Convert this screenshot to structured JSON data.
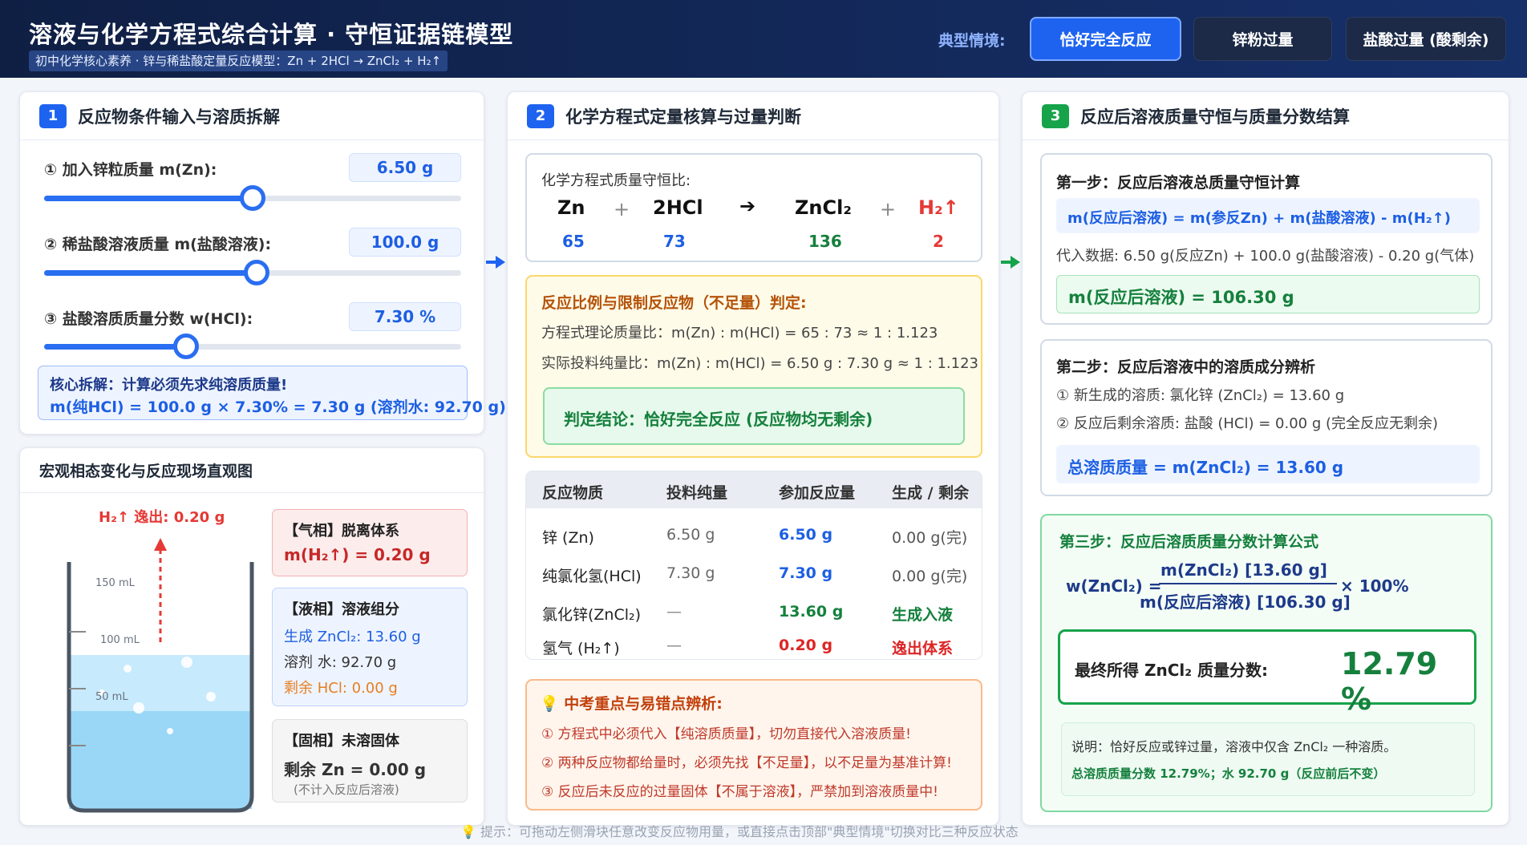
{
  "header": {
    "title": "溶液与化学方程式综合计算 · 守恒证据链模型",
    "subtitle": "初中化学核心素养 · 锌与稀盐酸定量反应模型：Zn + 2HCl → ZnCl₂ + H₂↑",
    "scenario_label": "典型情境:",
    "scenarios": [
      "恰好完全反应",
      "锌粉过量",
      "盐酸过量 (酸剩余)"
    ]
  },
  "panel1": {
    "num": "1",
    "title": "反应物条件输入与溶质拆解",
    "zn_label": "① 加入锌粒质量 m(Zn):",
    "zn_value": "6.50 g",
    "zn_fraction": 0.5,
    "hcl_sol_label": "② 稀盐酸溶液质量 m(盐酸溶液):",
    "hcl_sol_value": "100.0 g",
    "hcl_sol_fraction": 0.51,
    "w_label": "③ 盐酸溶质质量分数 w(HCl):",
    "w_value": "7.30 %",
    "w_fraction": 0.34,
    "core_line1": "核心拆解：计算必须先求纯溶质质量!",
    "core_line2": "m(纯HCl) = 100.0 g × 7.30% = 7.30 g (溶剂水: 92.70 g)"
  },
  "macro": {
    "title": "宏观相态变化与反应现场直观图",
    "h2_escape": "H₂↑ 逸出: 0.20 g",
    "marks": [
      "150 mL",
      "100 mL",
      "50 mL"
    ],
    "gas_title": "【气相】脱离体系",
    "gas_value": "m(H₂↑) = 0.20 g",
    "liquid_title": "【液相】溶液组分",
    "liquid_zncl2": "生成 ZnCl₂: 13.60 g",
    "liquid_water": "溶剂 水: 92.70 g",
    "liquid_hcl": "剩余 HCl: 0.00 g",
    "solid_title": "【固相】未溶固体",
    "solid_value": "剩余 Zn = 0.00 g",
    "solid_note": "(不计入反应后溶液)"
  },
  "panel2": {
    "num": "2",
    "title": "化学方程式定量核算与过量判断",
    "ratio_label": "化学方程式质量守恒比:",
    "eq": {
      "zn": "Zn",
      "plus1": "+",
      "hcl": "2HCl",
      "arrow": "➔",
      "zncl2": "ZnCl₂",
      "plus2": "+",
      "h2": "H₂↑",
      "zn_m": "65",
      "hcl_m": "73",
      "zncl2_m": "136",
      "h2_m": "2"
    },
    "judge_title": "反应比例与限制反应物（不足量）判定:",
    "theory": "方程式理论质量比：m(Zn) : m(HCl) = 65 : 73 ≈ 1 : 1.123",
    "actual": "实际投料纯量比：m(Zn) : m(HCl) = 6.50 g : 7.30 g ≈ 1 : 1.123",
    "conclusion": "判定结论：恰好完全反应 (反应物均无剩余)",
    "table": {
      "headers": [
        "反应物质",
        "投料纯量",
        "参加反应量",
        "生成 / 剩余"
      ],
      "rows": [
        [
          "锌 (Zn)",
          "6.50 g",
          "6.50 g",
          "0.00 g(完)"
        ],
        [
          "纯氯化氢(HCl)",
          "7.30 g",
          "7.30 g",
          "0.00 g(完)"
        ],
        [
          "氯化锌(ZnCl₂)",
          "—",
          "13.60 g",
          "生成入液"
        ],
        [
          "氢气 (H₂↑)",
          "—",
          "0.20 g",
          "逸出体系"
        ]
      ]
    },
    "tips_title": "中考重点与易错点辨析:",
    "tips": [
      "① 方程式中必须代入【纯溶质质量】，切勿直接代入溶液质量!",
      "② 两种反应物都给量时，必须先找【不足量】，以不足量为基准计算!",
      "③ 反应后未反应的过量固体【不属于溶液】，严禁加到溶液质量中!"
    ]
  },
  "panel3": {
    "num": "3",
    "title": "反应后溶液质量守恒与质量分数结算",
    "step1_title": "第一步：反应后溶液总质量守恒计算",
    "step1_formula": "m(反应后溶液) = m(参反Zn) + m(盐酸溶液) - m(H₂↑)",
    "step1_sub": "代入数据: 6.50 g(反应Zn) + 100.0 g(盐酸溶液) - 0.20 g(气体)",
    "step1_result": "m(反应后溶液) = 106.30 g",
    "step2_title": "第二步：反应后溶液中的溶质成分辨析",
    "step2_a": "① 新生成的溶质: 氯化锌 (ZnCl₂) = 13.60 g",
    "step2_b": "② 反应后剩余溶质: 盐酸 (HCl) = 0.00 g (完全反应无剩余)",
    "step2_total": "总溶质质量 = m(ZnCl₂) = 13.60 g",
    "step3_title": "第三步：反应后溶质质量分数计算公式",
    "w_lhs": "w(ZnCl₂) =",
    "numerator": "m(ZnCl₂) [13.60 g]",
    "denominator": "m(反应后溶液) [106.30 g]",
    "times": "× 100%",
    "final_label": "最终所得 ZnCl₂ 质量分数:",
    "final_value": "12.79 %",
    "explain1": "说明：恰好反应或锌过量，溶液中仅含 ZnCl₂ 一种溶质。",
    "explain2": "总溶质质量分数 12.79%；水 92.70 g（反应前后不变）"
  },
  "footer": "💡 提示：可拖动左侧滑块任意改变反应物用量，或直接点击顶部\"典型情境\"切换对比三种反应状态"
}
